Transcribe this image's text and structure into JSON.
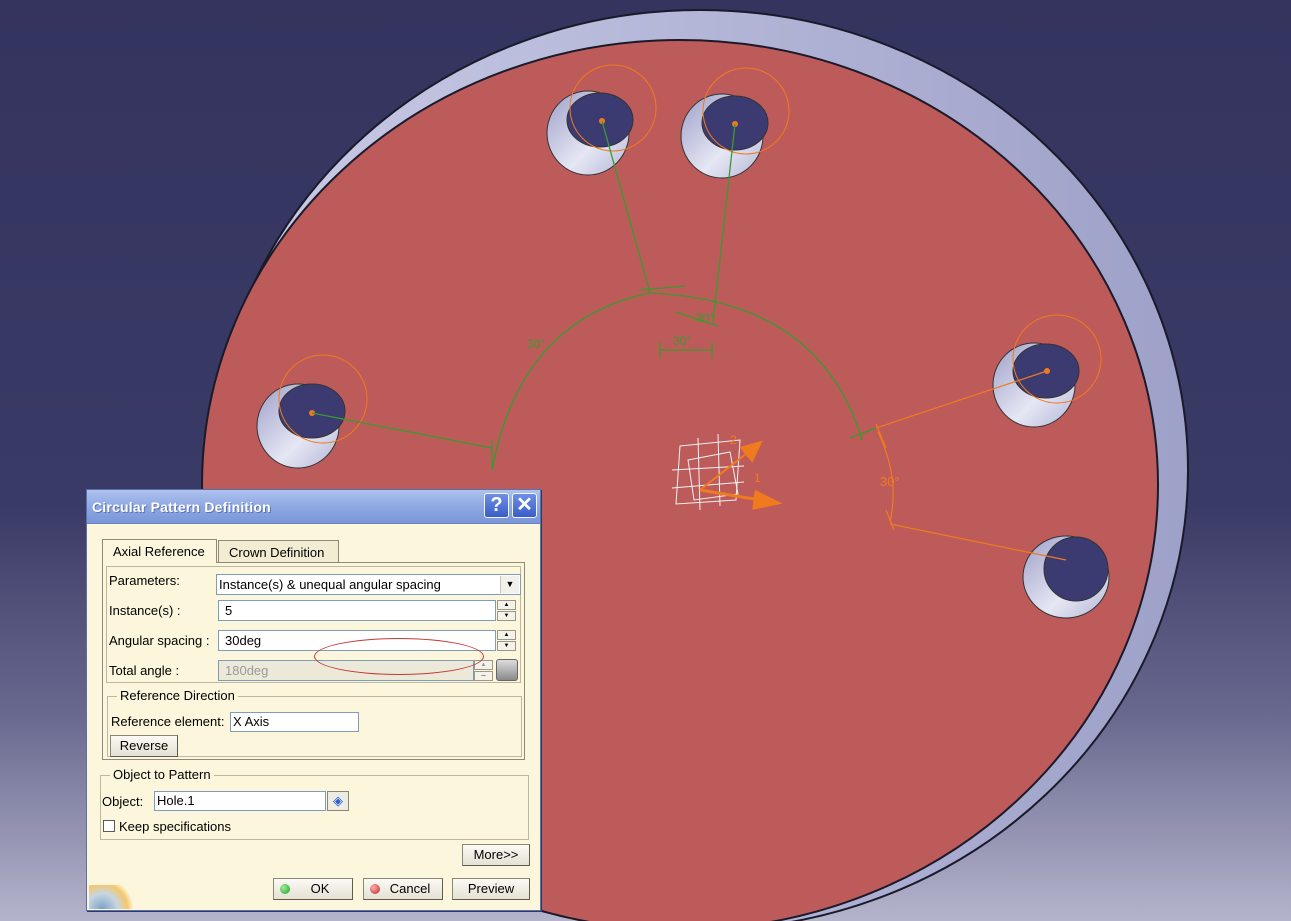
{
  "dialog": {
    "title": "Circular Pattern Definition",
    "help_glyph": "?",
    "close_glyph": "✕",
    "tabs": [
      {
        "label": "Axial Reference",
        "active": true
      },
      {
        "label": "Crown Definition",
        "active": false
      }
    ],
    "parameters": {
      "label": "Parameters:",
      "value": "Instance(s) & unequal angular spacing"
    },
    "instances": {
      "label": "Instance(s) :",
      "value": "5"
    },
    "angular_spacing": {
      "label": "Angular spacing :",
      "value": "30deg"
    },
    "total_angle": {
      "label": "Total angle :",
      "value": "180deg",
      "disabled": true
    },
    "reference_direction": {
      "legend": "Reference Direction",
      "element_label": "Reference element:",
      "element_value": "X Axis",
      "reverse_label": "Reverse"
    },
    "object_to_pattern": {
      "legend": "Object to Pattern",
      "object_label": "Object:",
      "object_value": "Hole.1",
      "keep_spec_label": "Keep specifications",
      "keep_spec_checked": false
    },
    "more_label": "More>>",
    "ok_label": "OK",
    "cancel_label": "Cancel",
    "preview_label": "Preview"
  },
  "viewport": {
    "angle_labels": [
      "30°",
      "30°",
      "30°",
      "30°"
    ],
    "axis_labels": [
      "1",
      "2"
    ],
    "colors": {
      "background": "#34345f",
      "part_face": "#bd5b5b",
      "part_rim": "#b5b7d6",
      "hole": "#3b3b72",
      "construction": "#3a9a2e",
      "highlight": "#f07a1e",
      "annotation": "#c23a3a"
    }
  }
}
